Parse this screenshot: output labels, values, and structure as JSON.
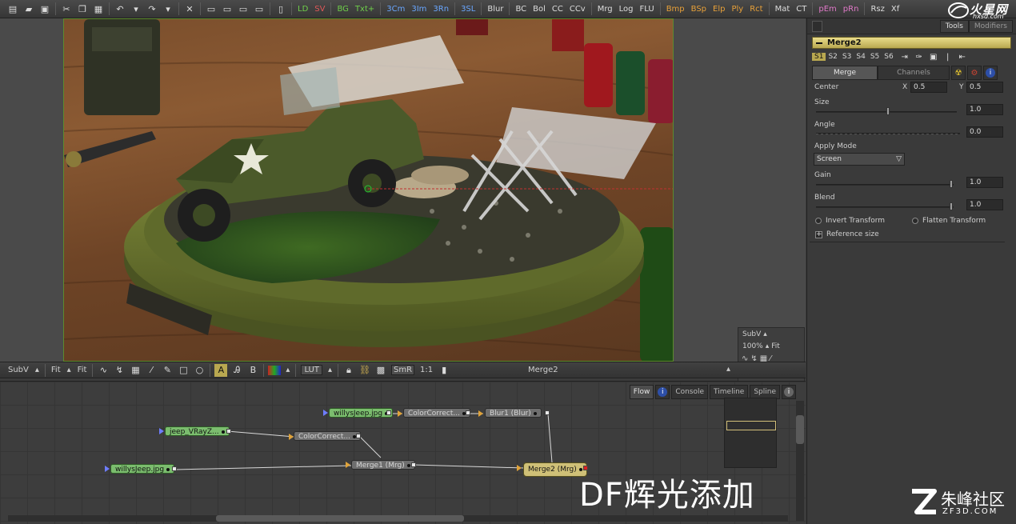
{
  "toolbar": {
    "labels": [
      {
        "text": "LD",
        "color": "green"
      },
      {
        "text": "SV",
        "color": "red"
      },
      {
        "text": "BG",
        "color": "green"
      },
      {
        "text": "Txt+",
        "color": "green"
      },
      {
        "text": "3Cm",
        "color": "blue"
      },
      {
        "text": "3Im",
        "color": "blue"
      },
      {
        "text": "3Rn",
        "color": "blue"
      },
      {
        "text": "3SL",
        "color": "blue"
      },
      {
        "text": "Blur",
        "color": "white"
      },
      {
        "text": "BC",
        "color": "white"
      },
      {
        "text": "Bol",
        "color": "white"
      },
      {
        "text": "CC",
        "color": "white"
      },
      {
        "text": "CCv",
        "color": "white"
      },
      {
        "text": "Mrg",
        "color": "white"
      },
      {
        "text": "Log",
        "color": "white"
      },
      {
        "text": "FLU",
        "color": "white"
      },
      {
        "text": "Bmp",
        "color": "orange"
      },
      {
        "text": "BSp",
        "color": "orange"
      },
      {
        "text": "Elp",
        "color": "orange"
      },
      {
        "text": "Ply",
        "color": "orange"
      },
      {
        "text": "Rct",
        "color": "orange"
      },
      {
        "text": "Mat",
        "color": "white"
      },
      {
        "text": "CT",
        "color": "white"
      },
      {
        "text": "pEm",
        "color": "pink"
      },
      {
        "text": "pRn",
        "color": "pink"
      },
      {
        "text": "Rsz",
        "color": "white"
      },
      {
        "text": "Xf",
        "color": "white"
      }
    ],
    "watermark": {
      "brand": "火星网",
      "url": "hxsd.com"
    }
  },
  "viewer": {
    "subv_panel": {
      "subv": "SubV",
      "zoom": "100%",
      "fit": "Fit"
    }
  },
  "viewer_bar": {
    "subv": "SubV",
    "fit1": "Fit",
    "fit2": "Fit",
    "lut": "LUT",
    "smr": "SmR",
    "ratio": "1:1",
    "node_name": "Merge2"
  },
  "flow": {
    "tabs": [
      "Flow",
      "Console",
      "Timeline",
      "Spline"
    ],
    "nodes": {
      "willys_top": "willysJeep.jpg",
      "colorcorrect_top": "ColorCorrect...",
      "blur1": "Blur1  (Blur)",
      "jeep_vray": "jeep_VRayZ...",
      "colorcorrect_mid": "ColorCorrect...",
      "willys_bottom": "willysJeep.jpg",
      "merge1": "Merge1  (Mrg)",
      "merge2": "Merge2  (Mrg)"
    }
  },
  "panel": {
    "tabs": {
      "tools": "Tools",
      "modifiers": "Modifiers"
    },
    "node_title": "Merge2",
    "scenes": [
      "S1",
      "S2",
      "S3",
      "S4",
      "S5",
      "S6"
    ],
    "control_tabs": {
      "merge": "Merge",
      "channels": "Channels"
    },
    "center": {
      "label": "Center",
      "x_label": "X",
      "x": "0.5",
      "y_label": "Y",
      "y": "0.5"
    },
    "size": {
      "label": "Size",
      "value": "1.0"
    },
    "angle": {
      "label": "Angle",
      "value": "0.0"
    },
    "apply_mode": {
      "label": "Apply Mode",
      "value": "Screen"
    },
    "gain": {
      "label": "Gain",
      "value": "1.0"
    },
    "blend": {
      "label": "Blend",
      "value": "1.0"
    },
    "invert_transform": "Invert Transform",
    "flatten_transform": "Flatten Transform",
    "reference_size": "Reference size"
  },
  "overlay": {
    "title": "DF辉光添加",
    "logo_cn": "朱峰社区",
    "logo_en": "ZF3D.COM"
  }
}
